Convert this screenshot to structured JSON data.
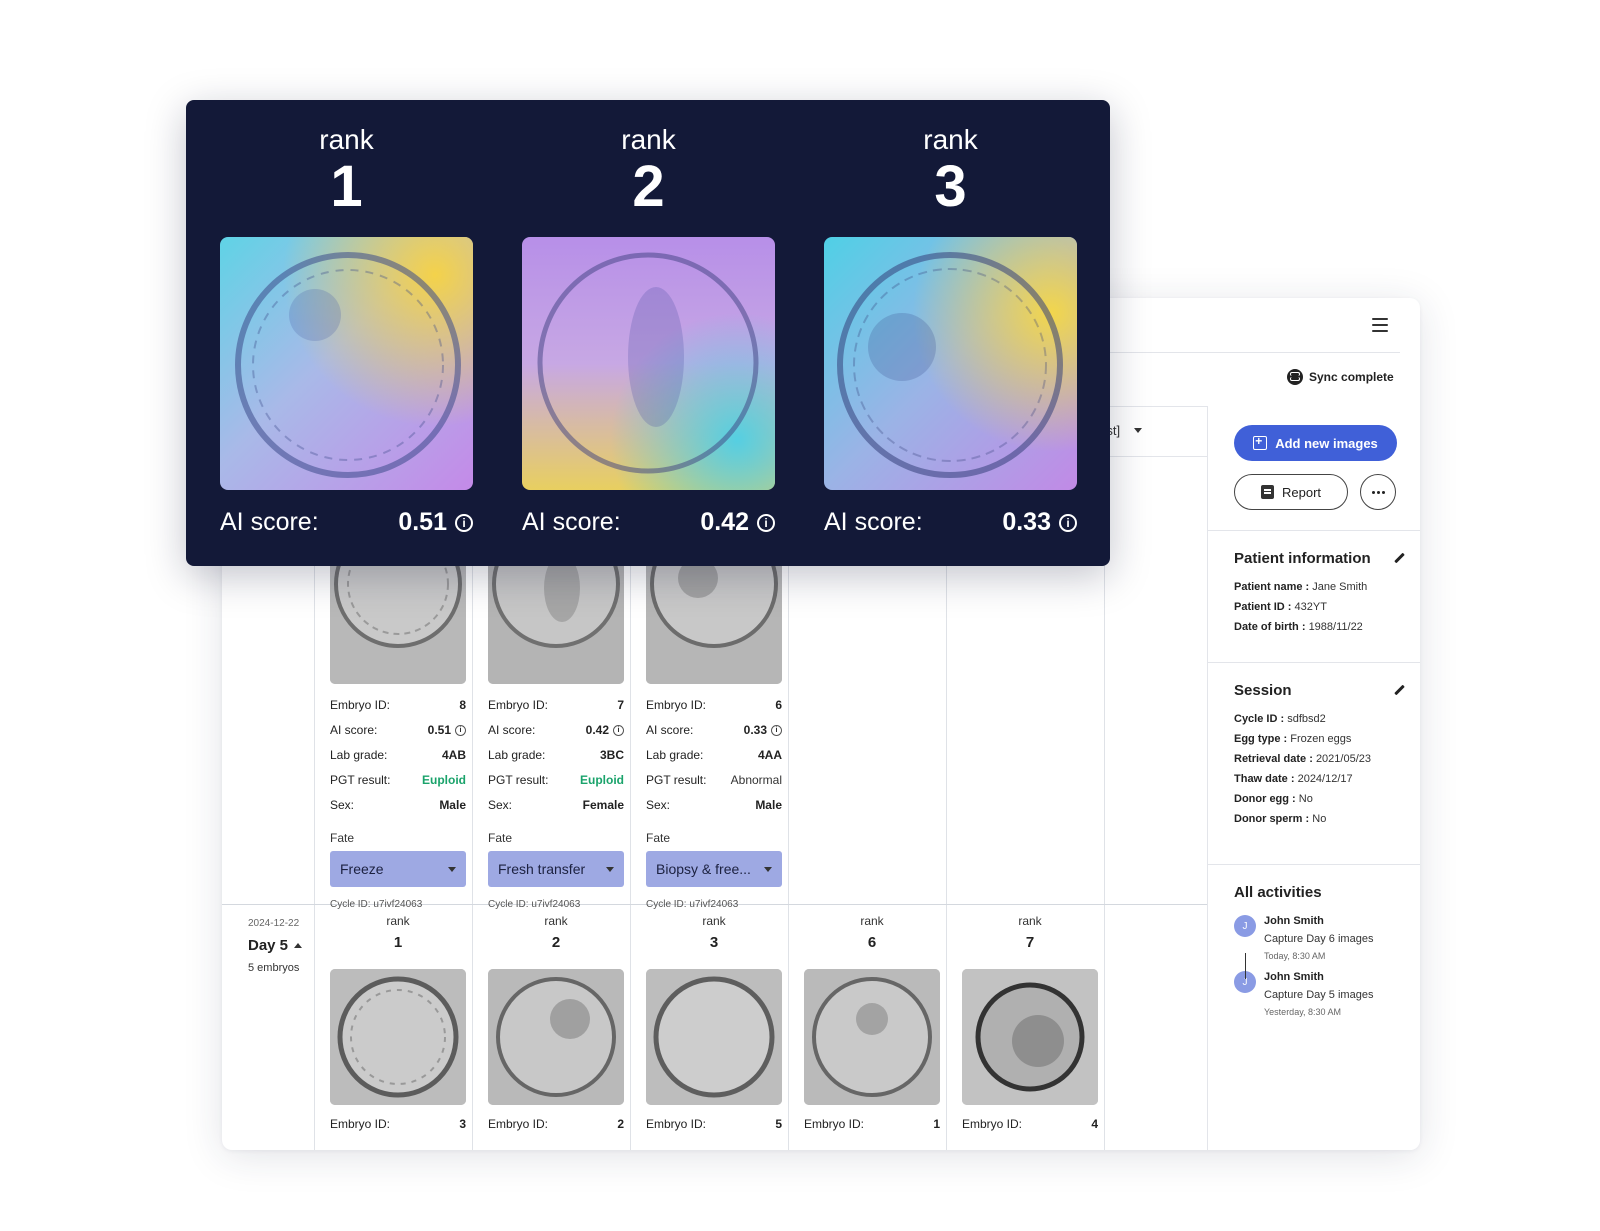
{
  "header": {
    "sync_status": "Sync complete",
    "sort_fragment": "rst]"
  },
  "ranking_panel": {
    "items": [
      {
        "rank_label": "rank",
        "rank": "1",
        "score_label": "AI score:",
        "score": "0.51"
      },
      {
        "rank_label": "rank",
        "rank": "2",
        "score_label": "AI score:",
        "score": "0.42"
      },
      {
        "rank_label": "rank",
        "rank": "3",
        "score_label": "AI score:",
        "score": "0.33"
      }
    ]
  },
  "labels": {
    "embryo_id": "Embryo ID:",
    "ai_score": "AI score:",
    "lab_grade": "Lab grade:",
    "pgt_result": "PGT result:",
    "sex": "Sex:",
    "fate": "Fate",
    "rank": "rank"
  },
  "top_cards": [
    {
      "embryo_id": "8",
      "ai_score": "0.51",
      "lab_grade": "4AB",
      "pgt": "Euploid",
      "sex": "Male",
      "fate": "Freeze",
      "cycle": "Cycle ID: u7ivf24063"
    },
    {
      "embryo_id": "7",
      "ai_score": "0.42",
      "lab_grade": "3BC",
      "pgt": "Euploid",
      "sex": "Female",
      "fate": "Fresh transfer",
      "cycle": "Cycle ID: u7ivf24063"
    },
    {
      "embryo_id": "6",
      "ai_score": "0.33",
      "lab_grade": "4AA",
      "pgt": "Abnormal",
      "sex": "Male",
      "fate": "Biopsy & free...",
      "cycle": "Cycle ID: u7ivf24063"
    }
  ],
  "day_group": {
    "date": "2024-12-22",
    "title": "Day 5",
    "count": "5 embryos"
  },
  "bottom_cards": [
    {
      "rank": "1",
      "embryo_id": "3"
    },
    {
      "rank": "2",
      "embryo_id": "2"
    },
    {
      "rank": "3",
      "embryo_id": "5"
    },
    {
      "rank": "6",
      "embryo_id": "1"
    },
    {
      "rank": "7",
      "embryo_id": "4"
    }
  ],
  "sidebar": {
    "add_images": "Add new images",
    "report": "Report",
    "patient": {
      "title": "Patient information",
      "name_label": "Patient name :",
      "name": "Jane Smith",
      "id_label": "Patient ID :",
      "id": "432YT",
      "dob_label": "Date of birth :",
      "dob": "1988/11/22"
    },
    "session": {
      "title": "Session",
      "cycle_label": "Cycle ID :",
      "cycle": "sdfbsd2",
      "egg_label": "Egg type :",
      "egg": "Frozen eggs",
      "retrieval_label": "Retrieval date :",
      "retrieval": "2021/05/23",
      "thaw_label": "Thaw date :",
      "thaw": "2024/12/17",
      "donor_egg_label": "Donor egg :",
      "donor_egg": "No",
      "donor_sperm_label": "Donor sperm :",
      "donor_sperm": "No"
    },
    "activities": {
      "title": "All activities",
      "items": [
        {
          "initial": "J",
          "name": "John Smith",
          "desc": "Capture Day 6 images",
          "time": "Today, 8:30 AM"
        },
        {
          "initial": "J",
          "name": "John Smith",
          "desc": "Capture Day 5 images",
          "time": "Yesterday, 8:30 AM"
        }
      ]
    }
  },
  "icons": [
    "menu-icon",
    "sync-icon",
    "chevron-down-icon",
    "add-image-icon",
    "report-icon",
    "more-icon",
    "edit-icon",
    "info-icon"
  ],
  "colors": {
    "panel_bg": "#131938",
    "primary": "#4060d8",
    "fate_select": "#9ea9e3",
    "euploid": "#1aa36b"
  }
}
